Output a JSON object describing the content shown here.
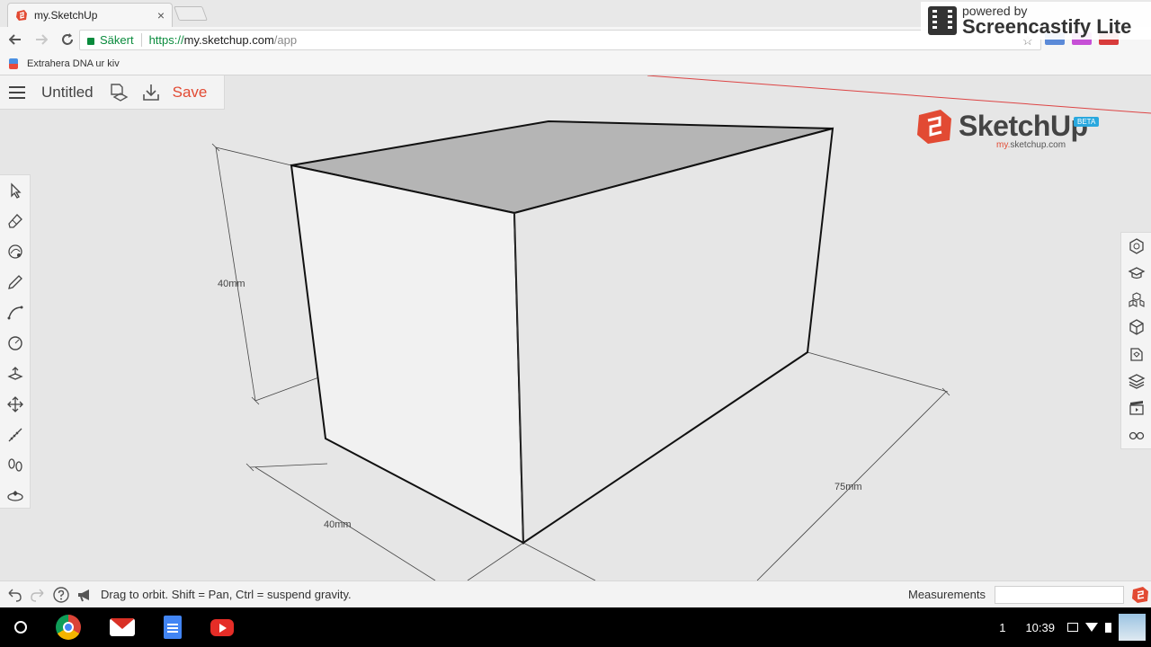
{
  "browser": {
    "tab_title": "my.SketchUp",
    "tab_close": "×",
    "secure_label": "Säkert",
    "url_scheme": "https://",
    "url_host": "my.sketchup.com",
    "url_path": "/app",
    "bookmark_label": "Extrahera DNA ur kiv"
  },
  "watermark": {
    "line1": "powered by",
    "line2": "Screencastify Lite"
  },
  "app": {
    "doc_title": "Untitled",
    "save_label": "Save",
    "brand_name": "SketchUp",
    "brand_badge": "BETA",
    "brand_sub_my": "my.",
    "brand_sub_rest": "sketchup.com",
    "accent_color": "#e24a33"
  },
  "model": {
    "dimension_height": "40mm",
    "dimension_width": "40mm",
    "dimension_length": "75mm"
  },
  "left_tools": [
    {
      "name": "select-icon"
    },
    {
      "name": "eraser-icon"
    },
    {
      "name": "paint-bucket-icon"
    },
    {
      "name": "pencil-icon"
    },
    {
      "name": "arc-icon"
    },
    {
      "name": "circle-icon"
    },
    {
      "name": "push-pull-icon"
    },
    {
      "name": "move-icon"
    },
    {
      "name": "tape-measure-icon"
    },
    {
      "name": "footprints-icon"
    },
    {
      "name": "orbit-icon"
    }
  ],
  "right_tools": [
    {
      "name": "entity-info-icon"
    },
    {
      "name": "instructor-icon"
    },
    {
      "name": "components-icon"
    },
    {
      "name": "materials-icon"
    },
    {
      "name": "styles-icon"
    },
    {
      "name": "layers-icon"
    },
    {
      "name": "scenes-icon"
    },
    {
      "name": "display-icon"
    }
  ],
  "statusbar": {
    "hint": "Drag to orbit. Shift = Pan, Ctrl = suspend gravity.",
    "measurements_label": "Measurements",
    "measurements_value": ""
  },
  "shelf": {
    "notification_count": "1",
    "clock": "10:39"
  }
}
